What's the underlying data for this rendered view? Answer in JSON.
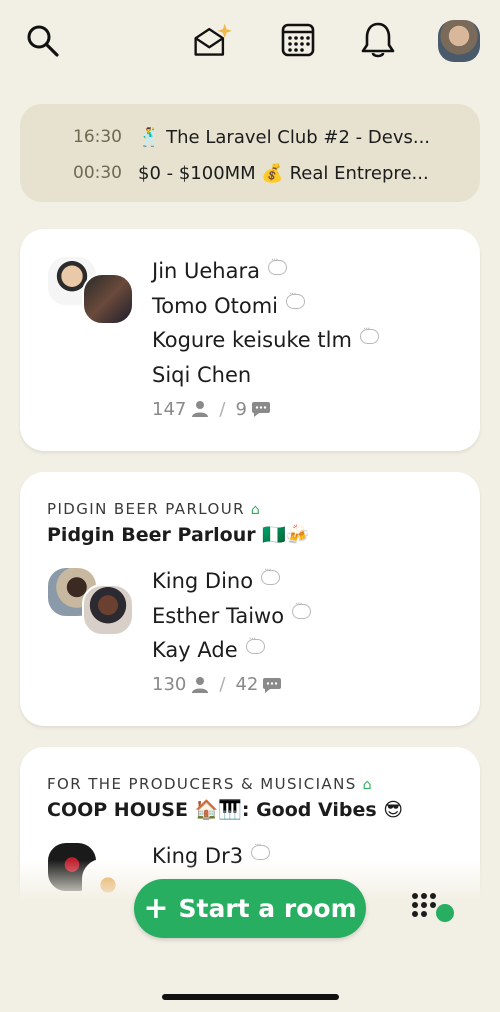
{
  "upcoming": [
    {
      "time": "16:30",
      "emoji": "🕺",
      "title": "The Laravel Club #2 - Devs..."
    },
    {
      "time": "00:30",
      "emoji": "",
      "title": "$0 - $100MM 💰 Real Entrepre..."
    }
  ],
  "rooms": [
    {
      "club": "",
      "title": "",
      "speakers": [
        "Jin Uehara",
        "Tomo Otomi",
        "Kogure keisuke tlm",
        "Siqi Chen"
      ],
      "listeners": "147",
      "speaker_count": "9"
    },
    {
      "club": "PIDGIN BEER PARLOUR",
      "title": "Pidgin Beer Parlour 🇳🇬🍻",
      "speakers": [
        "King Dino",
        "Esther Taiwo",
        "Kay Ade"
      ],
      "listeners": "130",
      "speaker_count": "42"
    },
    {
      "club": "FOR THE PRODUCERS & MUSICIANS",
      "title": "COOP HOUSE 🏠🎹: Good Vibes 😎",
      "speakers": [
        "King Dr3"
      ]
    }
  ],
  "actions": {
    "start_room": "Start a room"
  },
  "colors": {
    "accent": "#27ae60",
    "background": "#f2efe4",
    "upcoming_bg": "#e6e2cf"
  }
}
